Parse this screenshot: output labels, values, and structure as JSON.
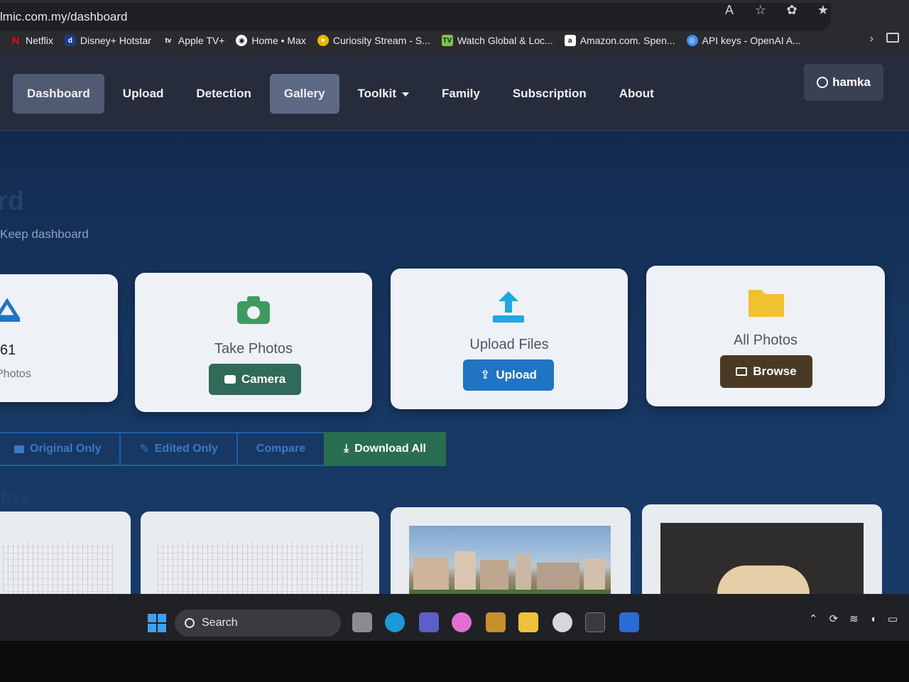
{
  "browser": {
    "url": "lmic.com.my/dashboard",
    "bookmarks": [
      {
        "label": "Netflix",
        "icon": "netflix-icon",
        "color": "#e50914",
        "glyph": "N"
      },
      {
        "label": "Disney+ Hotstar",
        "icon": "hotstar-icon",
        "color": "#1b3a8a",
        "glyph": "d"
      },
      {
        "label": "Apple TV+",
        "icon": "appletv-icon",
        "color": "#111111",
        "glyph": "tv"
      },
      {
        "label": "Home • Max",
        "icon": "max-icon",
        "color": "#ffffff",
        "glyph": "◉"
      },
      {
        "label": "Curiosity Stream - S...",
        "icon": "curiosity-icon",
        "color": "#f0b400",
        "glyph": "♥"
      },
      {
        "label": "Watch Global & Loc...",
        "icon": "tv-icon",
        "color": "#7ec34a",
        "glyph": "TV"
      },
      {
        "label": "Amazon.com. Spen...",
        "icon": "amazon-icon",
        "color": "#ffffff",
        "glyph": "a"
      },
      {
        "label": "API keys - OpenAI A...",
        "icon": "openai-icon",
        "color": "#3d8cf0",
        "glyph": "◎"
      }
    ]
  },
  "nav": {
    "items": [
      {
        "label": "Dashboard"
      },
      {
        "label": "Upload"
      },
      {
        "label": "Detection"
      },
      {
        "label": "Gallery"
      },
      {
        "label": "Toolkit"
      },
      {
        "label": "Family"
      },
      {
        "label": "Subscription"
      },
      {
        "label": "About"
      }
    ],
    "user": "hamka"
  },
  "page": {
    "title_fragment": "rd",
    "subtitle": "Keep dashboard",
    "stat": {
      "value": "61",
      "label": "Photos"
    },
    "cards": {
      "camera": {
        "label": "Take Photos",
        "button": "Camera"
      },
      "upload": {
        "label": "Upload Files",
        "button": "Upload"
      },
      "browse": {
        "label": "All Photos",
        "button": "Browse"
      }
    },
    "filters": [
      "Original Only",
      "Edited Only",
      "Compare",
      "Download All"
    ],
    "section_fragment": "tos"
  },
  "taskbar": {
    "search_placeholder": "Search"
  },
  "colors": {
    "camera_green": "#2f6b58",
    "upload_blue": "#1f74c4",
    "browse_brown": "#4a3a23",
    "folder_yellow": "#f2c12e",
    "download_green": "#2a6e52"
  }
}
